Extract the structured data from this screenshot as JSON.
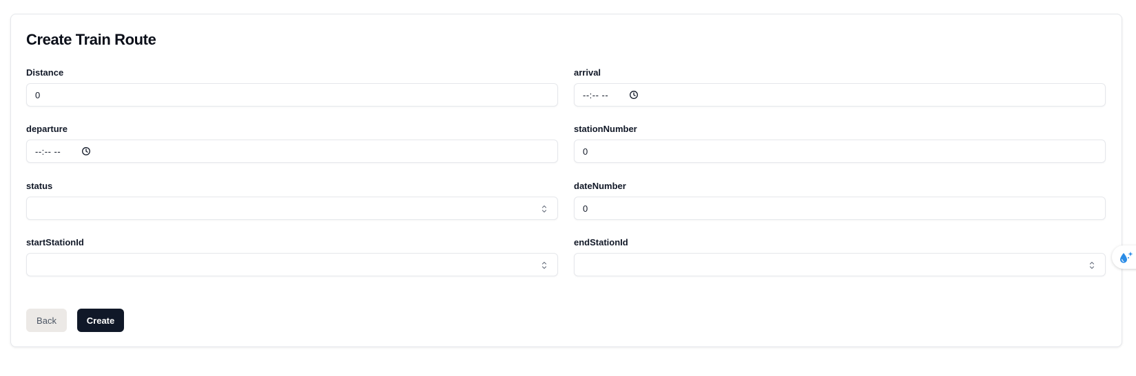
{
  "form": {
    "title": "Create Train Route",
    "fields": {
      "distance": {
        "label": "Distance",
        "value": "0"
      },
      "arrival": {
        "label": "arrival",
        "value": "--:-- --"
      },
      "departure": {
        "label": "departure",
        "value": "--:-- --"
      },
      "stationNumber": {
        "label": "stationNumber",
        "value": "0"
      },
      "status": {
        "label": "status",
        "value": ""
      },
      "dateNumber": {
        "label": "dateNumber",
        "value": "0"
      },
      "startStationId": {
        "label": "startStationId",
        "value": ""
      },
      "endStationId": {
        "label": "endStationId",
        "value": ""
      }
    },
    "buttons": {
      "back": "Back",
      "create": "Create"
    }
  },
  "icons": {
    "time": "clock-icon",
    "select": "chevron-up-down-icon",
    "floating": "water-drop-sparkle-icon"
  },
  "colors": {
    "primary_button": "#101828",
    "secondary_button": "#ece9e6",
    "border": "#e5e7eb",
    "accent_icon": "#2b8ce6"
  }
}
